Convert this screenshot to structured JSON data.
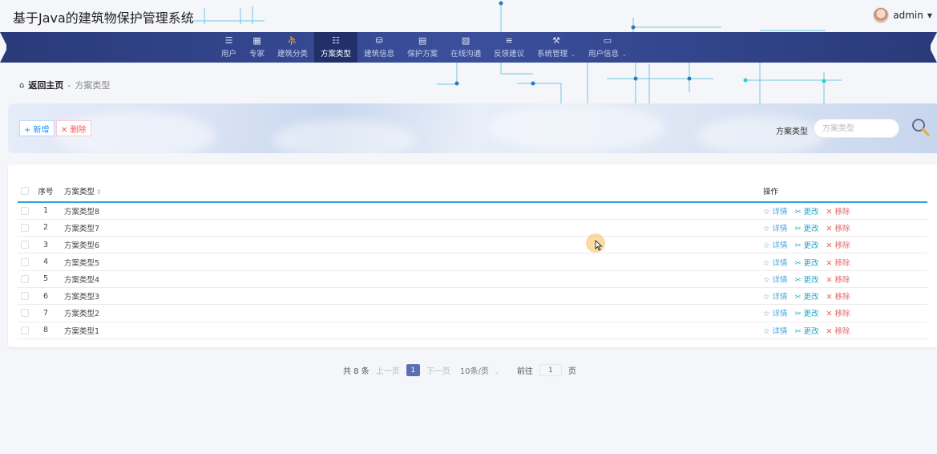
{
  "header": {
    "title": "基于Java的建筑物保护管理系统",
    "username": "admin"
  },
  "nav": {
    "items": [
      {
        "label": "用户",
        "icon": "menu-icon",
        "glyph": "☰"
      },
      {
        "label": "专家",
        "icon": "grid-icon",
        "glyph": "▦"
      },
      {
        "label": "建筑分类",
        "icon": "person-icon",
        "glyph": "⛹"
      },
      {
        "label": "方案类型",
        "icon": "sliders-icon",
        "glyph": "☷",
        "active": true
      },
      {
        "label": "建筑信息",
        "icon": "pin-icon",
        "glyph": "⛁"
      },
      {
        "label": "保护方案",
        "icon": "clipboard-icon",
        "glyph": "▤"
      },
      {
        "label": "在线沟通",
        "icon": "doc-icon",
        "glyph": "▧"
      },
      {
        "label": "反馈建议",
        "icon": "list-icon",
        "glyph": "≡"
      },
      {
        "label": "系统管理",
        "icon": "tools-icon",
        "glyph": "⚒",
        "dropdown": true
      },
      {
        "label": "用户信息",
        "icon": "window-icon",
        "glyph": "▭",
        "dropdown": true
      }
    ]
  },
  "breadcrumb": {
    "home": "返回主页",
    "sep": "-",
    "current": "方案类型"
  },
  "toolbar": {
    "add_label": "+ 新增",
    "delete_label": "✕ 删除",
    "search_label": "方案类型",
    "search_placeholder": "方案类型"
  },
  "table": {
    "columns": {
      "index": "序号",
      "type": "方案类型",
      "ops": "操作"
    },
    "rows": [
      {
        "index": "1",
        "type": "方案类型8"
      },
      {
        "index": "2",
        "type": "方案类型7"
      },
      {
        "index": "3",
        "type": "方案类型6"
      },
      {
        "index": "4",
        "type": "方案类型5"
      },
      {
        "index": "5",
        "type": "方案类型4"
      },
      {
        "index": "6",
        "type": "方案类型3"
      },
      {
        "index": "7",
        "type": "方案类型2"
      },
      {
        "index": "8",
        "type": "方案类型1"
      }
    ],
    "actions": {
      "detail": "☆ 详情",
      "edit": "✂ 更改",
      "remove": "✕ 移除"
    }
  },
  "pagination": {
    "total": "共 8 条",
    "prev": "上一页",
    "page": "1",
    "next": "下一页",
    "size": "10条/页",
    "goto_label": "前往",
    "goto_value": "1",
    "goto_suffix": "页"
  },
  "colors": {
    "nav_bg": "#2a3a7a",
    "nav_active": "#22306a",
    "accent_blue": "#2fa3d8",
    "remove_red": "#e26a6a"
  }
}
